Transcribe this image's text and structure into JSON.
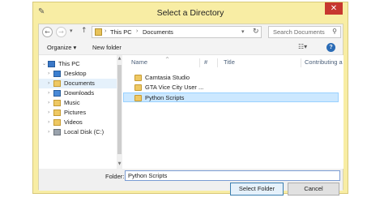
{
  "window": {
    "title": "Select a Directory",
    "close_glyph": "✕",
    "app_glyph": "✎"
  },
  "nav": {
    "back_glyph": "←",
    "forward_glyph": "→",
    "history_glyph": "▾",
    "up_glyph": "↑",
    "refresh_glyph": "↻",
    "path": [
      "This PC",
      "Documents"
    ],
    "path_sep": "›",
    "dropdown_glyph": "▾"
  },
  "search": {
    "placeholder": "Search Documents",
    "icon_glyph": "⚲"
  },
  "toolbar": {
    "organize_label": "Organize ▾",
    "new_folder_label": "New folder",
    "view_glyph": "☷▾",
    "help_glyph": "?"
  },
  "navpane": {
    "items": [
      {
        "label": "This PC",
        "icon": "pc-icon",
        "arrow": "⌄"
      },
      {
        "label": "Desktop",
        "icon": "desktop-icon",
        "arrow": "›"
      },
      {
        "label": "Documents",
        "icon": "documents-icon",
        "arrow": "›"
      },
      {
        "label": "Downloads",
        "icon": "downloads-icon",
        "arrow": "›"
      },
      {
        "label": "Music",
        "icon": "music-icon",
        "arrow": "›"
      },
      {
        "label": "Pictures",
        "icon": "pictures-icon",
        "arrow": "›"
      },
      {
        "label": "Videos",
        "icon": "videos-icon",
        "arrow": "›"
      },
      {
        "label": "Local Disk (C:)",
        "icon": "disk-icon",
        "arrow": "›"
      }
    ],
    "scroll_up": "▲",
    "scroll_down": "▼"
  },
  "filelist": {
    "columns": [
      "Name",
      "#",
      "Title",
      "Contributing a"
    ],
    "sort_glyph": "^",
    "rows": [
      "Camtasia Studio",
      "GTA Vice City User ...",
      "Python Scripts"
    ]
  },
  "footer": {
    "folder_label": "Folder:",
    "folder_value": "Python Scripts",
    "select_label": "Select Folder",
    "cancel_label": "Cancel"
  },
  "colors": {
    "frame": "#f8eda4",
    "close": "#c7372f",
    "selection": "#cce8ff",
    "folder": "#eec863"
  }
}
